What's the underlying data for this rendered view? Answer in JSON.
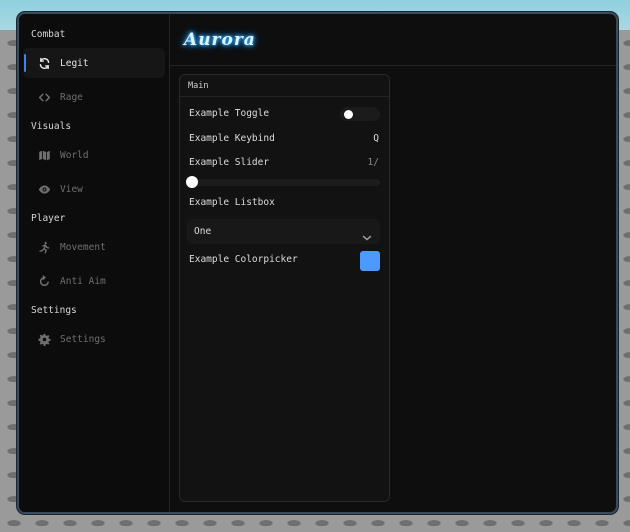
{
  "app": {
    "logo_text": "Aurora"
  },
  "sidebar": {
    "sections": [
      {
        "title": "Combat",
        "items": [
          {
            "label": "Legit",
            "icon": "sync-icon",
            "active": true
          },
          {
            "label": "Rage",
            "icon": "code-icon"
          }
        ]
      },
      {
        "title": "Visuals",
        "items": [
          {
            "label": "World",
            "icon": "map-icon"
          },
          {
            "label": "View",
            "icon": "eye-icon"
          }
        ]
      },
      {
        "title": "Player",
        "items": [
          {
            "label": "Movement",
            "icon": "running-icon"
          },
          {
            "label": "Anti Aim",
            "icon": "refresh-icon"
          }
        ]
      },
      {
        "title": "Settings",
        "items": [
          {
            "label": "Settings",
            "icon": "gear-icon"
          }
        ]
      }
    ]
  },
  "panel": {
    "title": "Main",
    "toggle": {
      "label": "Example Toggle",
      "value": false
    },
    "keybind": {
      "label": "Example Keybind",
      "key": "Q"
    },
    "slider": {
      "label": "Example Slider",
      "value_text": "1/",
      "fraction": 0
    },
    "listbox": {
      "label": "Example Listbox",
      "selected": "One"
    },
    "colorpicker": {
      "label": "Example Colorpicker",
      "color": "#4c9aff"
    }
  },
  "colors": {
    "accent": "#3f82f3",
    "window_border": "#3a4a5a"
  }
}
